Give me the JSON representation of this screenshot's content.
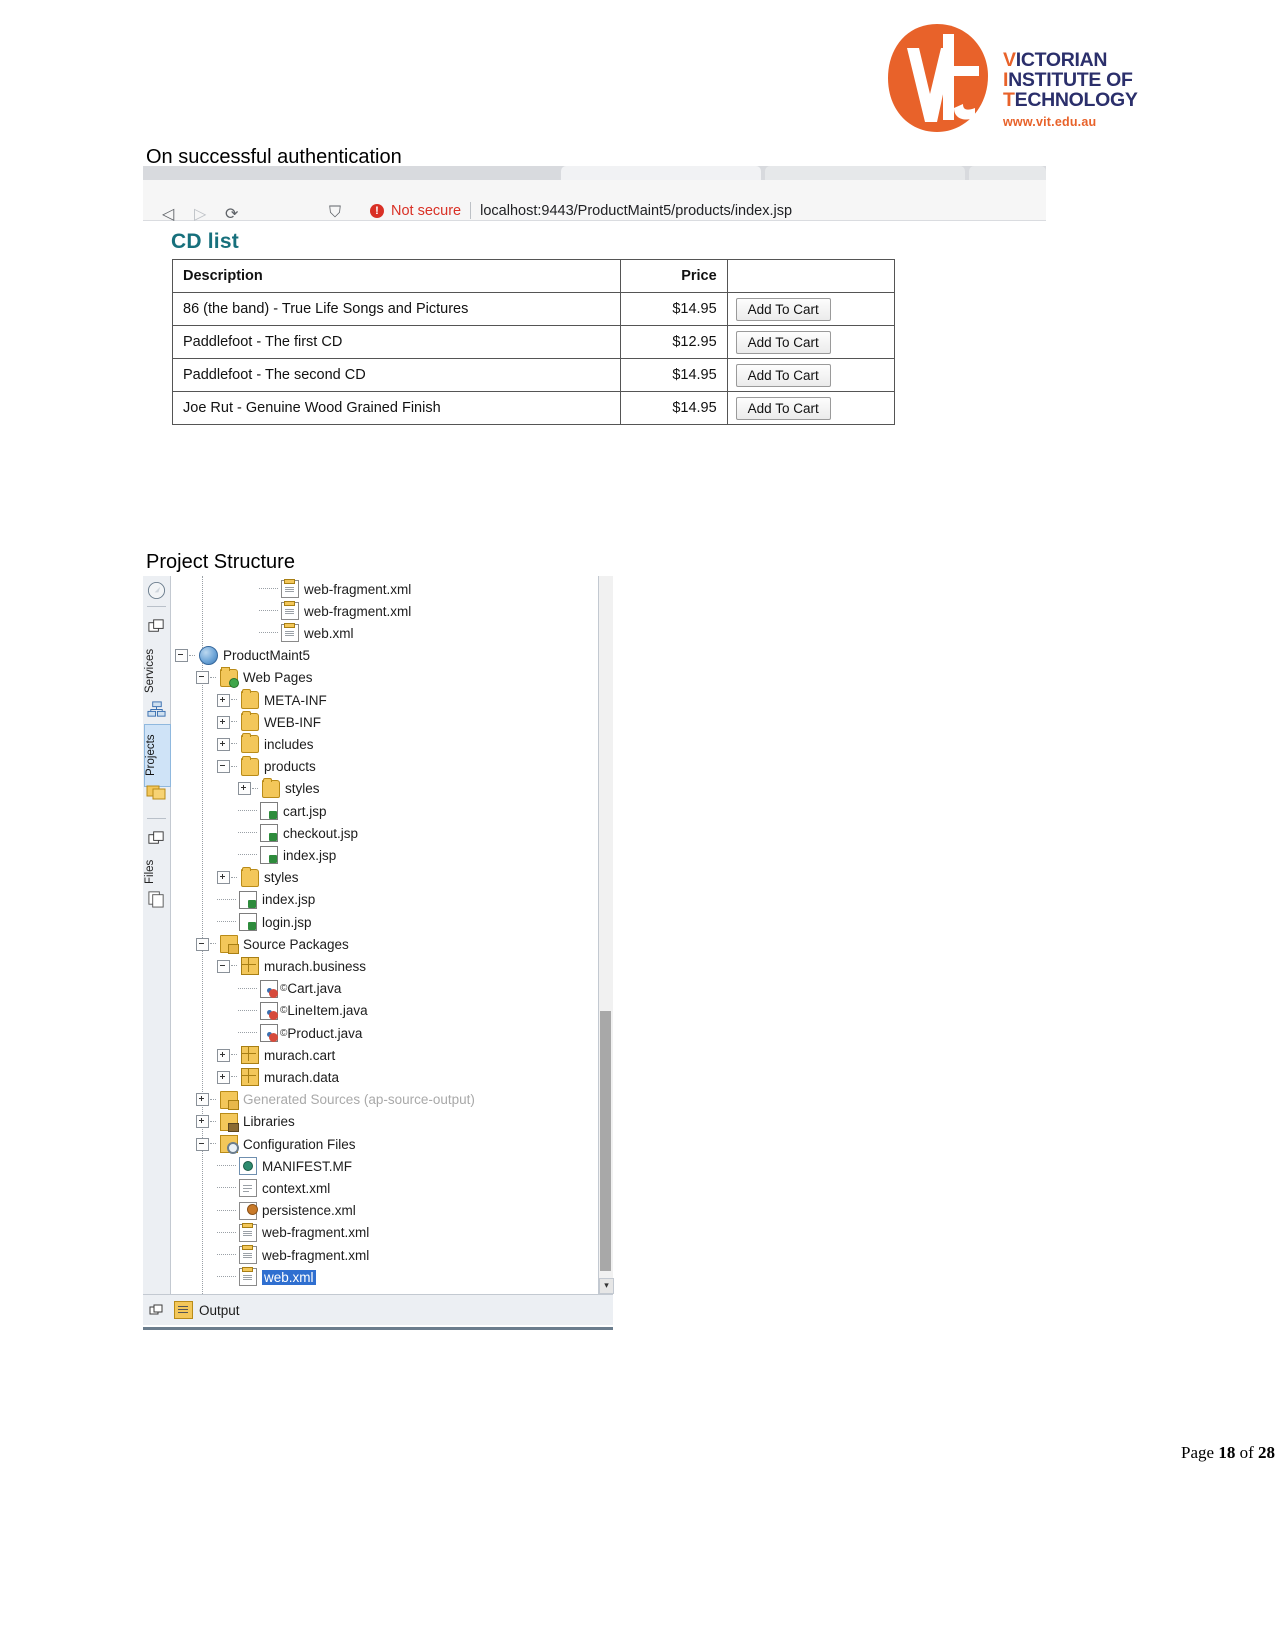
{
  "logo": {
    "line1_accent": "V",
    "line1_rest": "ICTORIAN",
    "line2_accent": "I",
    "line2_rest": "NSTITUTE OF",
    "line3_accent": "T",
    "line3_rest": "ECHNOLOGY",
    "url": "www.vit.edu.au",
    "orange": "#e8622a",
    "navy": "#2b2f6b"
  },
  "headings": {
    "authentication": "On successful authentication",
    "project_structure": "Project Structure"
  },
  "browser": {
    "security_label": "Not secure",
    "security_icon": "exclamation-circle-icon",
    "url": "localhost:9443/ProductMaint5/products/index.jsp",
    "back_icon": "◁",
    "forward_icon": "▷",
    "reload_icon": "⟳",
    "bookmark_icon": "⛉"
  },
  "cd_page": {
    "title": "CD list",
    "title_color": "#17707c",
    "columns": [
      "Description",
      "Price",
      ""
    ],
    "rows": [
      {
        "description": "86 (the band) - True Life Songs and Pictures",
        "price": "$14.95",
        "button": "Add To Cart"
      },
      {
        "description": "Paddlefoot - The first CD",
        "price": "$12.95",
        "button": "Add To Cart"
      },
      {
        "description": "Paddlefoot - The second CD",
        "price": "$14.95",
        "button": "Add To Cart"
      },
      {
        "description": "Joe Rut - Genuine Wood Grained Finish",
        "price": "$14.95",
        "button": "Add To Cart"
      }
    ]
  },
  "ide": {
    "rail_tabs": [
      {
        "label": "Services",
        "icon": "services-icon",
        "selected": false
      },
      {
        "label": "Projects",
        "icon": "projects-icon",
        "selected": true
      },
      {
        "label": "Files",
        "icon": "files-icon",
        "selected": false
      }
    ],
    "status_bar": {
      "label": "Output",
      "icon": "output-icon"
    },
    "tree": [
      {
        "label": "web-fragment.xml",
        "depth": 4,
        "icon": "xml-file-icon",
        "toggle": "none",
        "dim": false,
        "selected": false
      },
      {
        "label": "web-fragment.xml",
        "depth": 4,
        "icon": "xml-file-icon",
        "toggle": "none",
        "dim": false,
        "selected": false
      },
      {
        "label": "web.xml",
        "depth": 4,
        "icon": "xml-file-icon",
        "toggle": "none",
        "dim": false,
        "selected": false
      },
      {
        "label": "ProductMaint5",
        "depth": 0,
        "icon": "project-icon",
        "toggle": "minus",
        "dim": false,
        "selected": false
      },
      {
        "label": "Web Pages",
        "depth": 1,
        "icon": "webpages-icon",
        "toggle": "minus",
        "dim": false,
        "selected": false
      },
      {
        "label": "META-INF",
        "depth": 2,
        "icon": "folder-icon",
        "toggle": "plus",
        "dim": false,
        "selected": false
      },
      {
        "label": "WEB-INF",
        "depth": 2,
        "icon": "folder-icon",
        "toggle": "plus",
        "dim": false,
        "selected": false
      },
      {
        "label": "includes",
        "depth": 2,
        "icon": "folder-icon",
        "toggle": "plus",
        "dim": false,
        "selected": false
      },
      {
        "label": "products",
        "depth": 2,
        "icon": "folder-icon",
        "toggle": "minus",
        "dim": false,
        "selected": false
      },
      {
        "label": "styles",
        "depth": 3,
        "icon": "folder-icon",
        "toggle": "plus",
        "dim": false,
        "selected": false
      },
      {
        "label": "cart.jsp",
        "depth": 3,
        "icon": "jsp-file-icon",
        "toggle": "none",
        "dim": false,
        "selected": false
      },
      {
        "label": "checkout.jsp",
        "depth": 3,
        "icon": "jsp-file-icon",
        "toggle": "none",
        "dim": false,
        "selected": false
      },
      {
        "label": "index.jsp",
        "depth": 3,
        "icon": "jsp-file-icon",
        "toggle": "none",
        "dim": false,
        "selected": false
      },
      {
        "label": "styles",
        "depth": 2,
        "icon": "folder-icon",
        "toggle": "plus",
        "dim": false,
        "selected": false
      },
      {
        "label": "index.jsp",
        "depth": 2,
        "icon": "jsp-file-icon",
        "toggle": "none",
        "dim": false,
        "selected": false
      },
      {
        "label": "login.jsp",
        "depth": 2,
        "icon": "jsp-file-icon",
        "toggle": "none",
        "dim": false,
        "selected": false
      },
      {
        "label": "Source Packages",
        "depth": 1,
        "icon": "source-packages-icon",
        "toggle": "minus",
        "dim": false,
        "selected": false
      },
      {
        "label": "murach.business",
        "depth": 2,
        "icon": "package-icon",
        "toggle": "minus",
        "dim": false,
        "selected": false
      },
      {
        "label": "Cart.java",
        "depth": 3,
        "icon": "java-file-icon",
        "toggle": "none",
        "dim": false,
        "selected": false,
        "badge": true
      },
      {
        "label": "LineItem.java",
        "depth": 3,
        "icon": "java-file-icon",
        "toggle": "none",
        "dim": false,
        "selected": false,
        "badge": true
      },
      {
        "label": "Product.java",
        "depth": 3,
        "icon": "java-file-icon",
        "toggle": "none",
        "dim": false,
        "selected": false,
        "badge": true
      },
      {
        "label": "murach.cart",
        "depth": 2,
        "icon": "package-icon",
        "toggle": "plus",
        "dim": false,
        "selected": false
      },
      {
        "label": "murach.data",
        "depth": 2,
        "icon": "package-icon",
        "toggle": "plus",
        "dim": false,
        "selected": false
      },
      {
        "label": "Generated Sources (ap-source-output)",
        "depth": 1,
        "icon": "source-packages-icon",
        "toggle": "plus",
        "dim": true,
        "selected": false
      },
      {
        "label": "Libraries",
        "depth": 1,
        "icon": "libraries-icon",
        "toggle": "plus",
        "dim": false,
        "selected": false
      },
      {
        "label": "Configuration Files",
        "depth": 1,
        "icon": "config-files-icon",
        "toggle": "minus",
        "dim": false,
        "selected": false
      },
      {
        "label": "MANIFEST.MF",
        "depth": 2,
        "icon": "manifest-icon",
        "toggle": "none",
        "dim": false,
        "selected": false
      },
      {
        "label": "context.xml",
        "depth": 2,
        "icon": "context-xml-icon",
        "toggle": "none",
        "dim": false,
        "selected": false
      },
      {
        "label": "persistence.xml",
        "depth": 2,
        "icon": "persistence-icon",
        "toggle": "none",
        "dim": false,
        "selected": false
      },
      {
        "label": "web-fragment.xml",
        "depth": 2,
        "icon": "xml-file-icon",
        "toggle": "none",
        "dim": false,
        "selected": false
      },
      {
        "label": "web-fragment.xml",
        "depth": 2,
        "icon": "xml-file-icon",
        "toggle": "none",
        "dim": false,
        "selected": false
      },
      {
        "label": "web.xml",
        "depth": 2,
        "icon": "xml-file-icon",
        "toggle": "none",
        "dim": false,
        "selected": true
      }
    ]
  },
  "footer": {
    "prefix": "Page ",
    "page": "18",
    "middle": " of ",
    "total": "28"
  }
}
